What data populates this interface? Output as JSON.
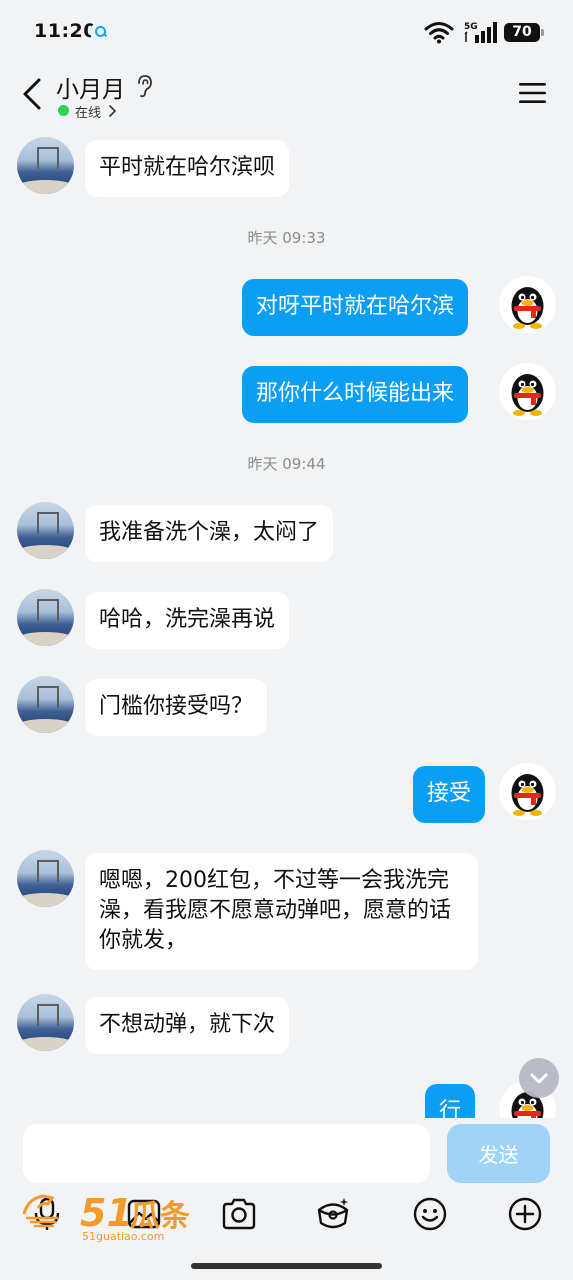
{
  "status_bar": {
    "time": "11:20",
    "battery": "70",
    "network": "5G"
  },
  "header": {
    "contact_name": "小月月",
    "online_status": "在线"
  },
  "messages": [
    {
      "side": "left",
      "text": "平时就在哈尔滨呗"
    },
    {
      "type": "time",
      "text": "昨天 09:33"
    },
    {
      "side": "right",
      "text": "对呀平时就在哈尔滨"
    },
    {
      "side": "right",
      "text": "那你什么时候能出来"
    },
    {
      "type": "time",
      "text": "昨天 09:44"
    },
    {
      "side": "left",
      "text": "我准备洗个澡，太闷了"
    },
    {
      "side": "left",
      "text": "哈哈，洗完澡再说"
    },
    {
      "side": "left",
      "text": "门槛你接受吗？"
    },
    {
      "side": "right",
      "text": "接受"
    },
    {
      "side": "left",
      "text": "嗯嗯，200红包，不过等一会我洗完澡，看我愿不愿意动弹吧，愿意的话你就发，"
    },
    {
      "side": "left",
      "text": "不想动弹，就下次"
    },
    {
      "side": "right",
      "text": "行"
    }
  ],
  "input": {
    "placeholder": "",
    "send_label": "发送"
  },
  "toolbar": {
    "icons": [
      "microphone-icon",
      "image-icon",
      "camera-icon",
      "red-packet-icon",
      "emoji-icon",
      "plus-icon"
    ]
  },
  "watermark": {
    "brand": "51",
    "brand_cn": "瓜条",
    "domain": "51guatiao.com"
  },
  "colors": {
    "accent": "#0a9ff5",
    "background": "#f2f3f5",
    "send_disabled": "#9fd4f8",
    "online": "#2fd15a",
    "watermark": "#f39a2a"
  }
}
